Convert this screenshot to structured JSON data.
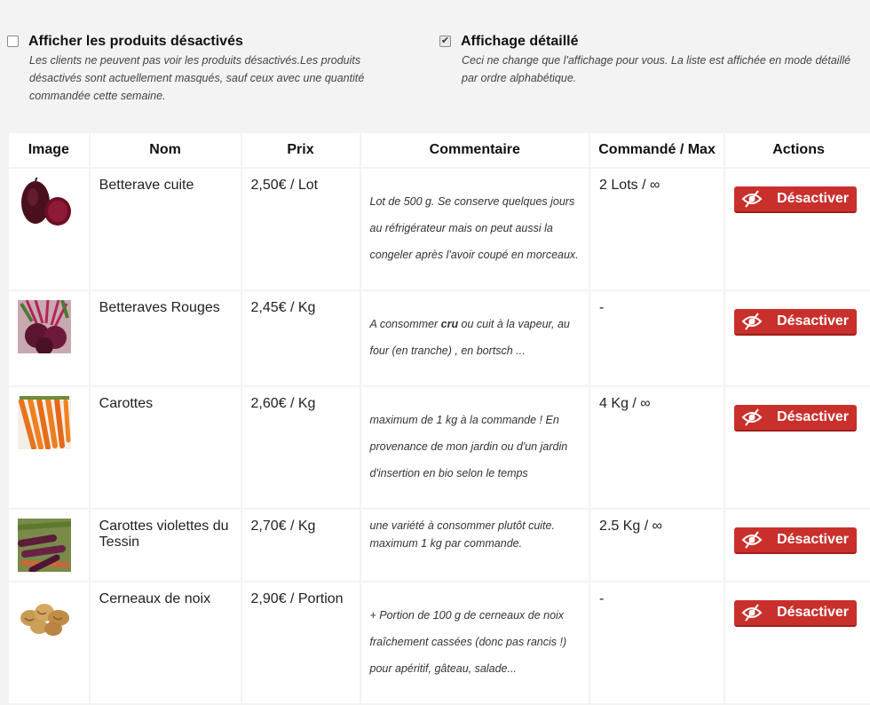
{
  "options": {
    "inactive": {
      "label": "Afficher les produits désactivés",
      "checked": false,
      "desc_lines": [
        "Les clients ne peuvent pas voir les produits désactivés.Les produits",
        "désactivés sont actuellement masqués, sauf ceux avec une quantité",
        "commandée cette semaine."
      ]
    },
    "detailed": {
      "label": "Affichage détaillé",
      "checked": true,
      "check_mark": "✔",
      "desc_lines": [
        "Ceci ne change que l'affichage pour vous. La liste est affichée en mode détaillé",
        "par ordre alphabétique."
      ]
    }
  },
  "table": {
    "headers": {
      "image": "Image",
      "name": "Nom",
      "price": "Prix",
      "comment": "Commentaire",
      "ordered": "Commandé / Max",
      "actions": "Actions"
    },
    "action_label": "Désactiver",
    "action_icon": "eye-slash-icon",
    "rows": [
      {
        "image": "beetroot-cooked-photo",
        "name_lines": [
          "Betterave cuite"
        ],
        "price": "2,50€ / Lot",
        "comment_lines": [
          "Lot de 500 g. Se conserve quelques jours",
          "au réfrigérateur mais on peut aussi la",
          "congeler après l'avoir coupé en morceaux."
        ],
        "ordered": "2 Lots / ∞"
      },
      {
        "image": "red-beets-photo",
        "name_lines": [
          "Betteraves Rouges"
        ],
        "price": "2,45€ / Kg",
        "comment_parts": [
          "A consommer ",
          "cru",
          " ou cuit à la vapeur, au"
        ],
        "comment_lines": [
          "four (en tranche) , en bortsch ..."
        ],
        "ordered": "-"
      },
      {
        "image": "carrots-photo",
        "name_lines": [
          "Carottes"
        ],
        "price": "2,60€ / Kg",
        "comment_lines": [
          "maximum de 1 kg à la commande ! En",
          "provenance de mon jardin ou d'un jardin",
          "d'insertion en bio selon le temps"
        ],
        "ordered": "4 Kg / ∞"
      },
      {
        "image": "purple-carrots-photo",
        "name_lines": [
          "Carottes violettes du",
          "Tessin"
        ],
        "price": "2,70€ / Kg",
        "comment_lines": [
          "une variété à consommer plutôt cuite.",
          "maximum 1 kg par commande."
        ],
        "ordered": "2.5 Kg / ∞"
      },
      {
        "image": "walnut-kernels-photo",
        "name_lines": [
          "Cerneaux de noix"
        ],
        "price": "2,90€ / Portion",
        "comment_lines": [
          "+ Portion de 100 g de cerneaux de noix",
          "fraîchement cassées  (donc pas rancis !)",
          "pour apéritif, gâteau, salade..."
        ],
        "ordered": "-"
      }
    ]
  },
  "colors": {
    "button": "#c9302c",
    "page_bg": "#f3f3f3"
  }
}
